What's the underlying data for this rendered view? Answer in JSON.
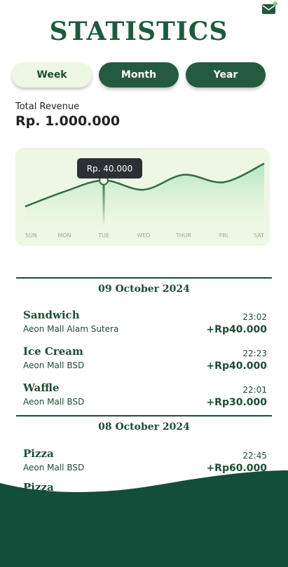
{
  "header": {
    "title": "STATISTICS",
    "mail_icon": "mail-notification-icon",
    "notification_dot_color": "#7ed957"
  },
  "tabs": [
    {
      "label": "Week",
      "active": true
    },
    {
      "label": "Month",
      "active": false
    },
    {
      "label": "Year",
      "active": false
    }
  ],
  "revenue": {
    "label": "Total Revenue",
    "value": "Rp. 1.000.000"
  },
  "chart": {
    "tooltip": "Rp. 40.000",
    "highlight_day": "TUE",
    "days": [
      "SUN",
      "MON",
      "TUE",
      "WED",
      "THUR",
      "FRI",
      "SAT"
    ]
  },
  "chart_data": {
    "type": "area",
    "categories": [
      "SUN",
      "MON",
      "TUE",
      "WED",
      "THUR",
      "FRI",
      "SAT"
    ],
    "values": [
      12000,
      28000,
      40000,
      30000,
      46000,
      38000,
      58000
    ],
    "title": "",
    "xlabel": "",
    "ylabel": "",
    "grid": false
  },
  "groups": [
    {
      "date": "09 October 2024",
      "items": [
        {
          "name": "Sandwich",
          "place": "Aeon Mall Alam Sutera",
          "time": "23:02",
          "amount": "+Rp40.000"
        },
        {
          "name": "Ice Cream",
          "place": "Aeon Mall BSD",
          "time": "22:23",
          "amount": "+Rp40.000"
        },
        {
          "name": "Waffle",
          "place": "Aeon Mall BSD",
          "time": "22:01",
          "amount": "+Rp30.000"
        }
      ]
    },
    {
      "date": "08 October 2024",
      "items": [
        {
          "name": "Pizza",
          "place": "Aeon Mall BSD",
          "time": "22:45",
          "amount": "+Rp60.000"
        },
        {
          "name": "Pizza",
          "place": "",
          "time": "",
          "amount": ""
        }
      ]
    }
  ],
  "colors": {
    "primary": "#1e4d34",
    "accent_light": "#eef7e3",
    "footer": "#134e3b"
  }
}
